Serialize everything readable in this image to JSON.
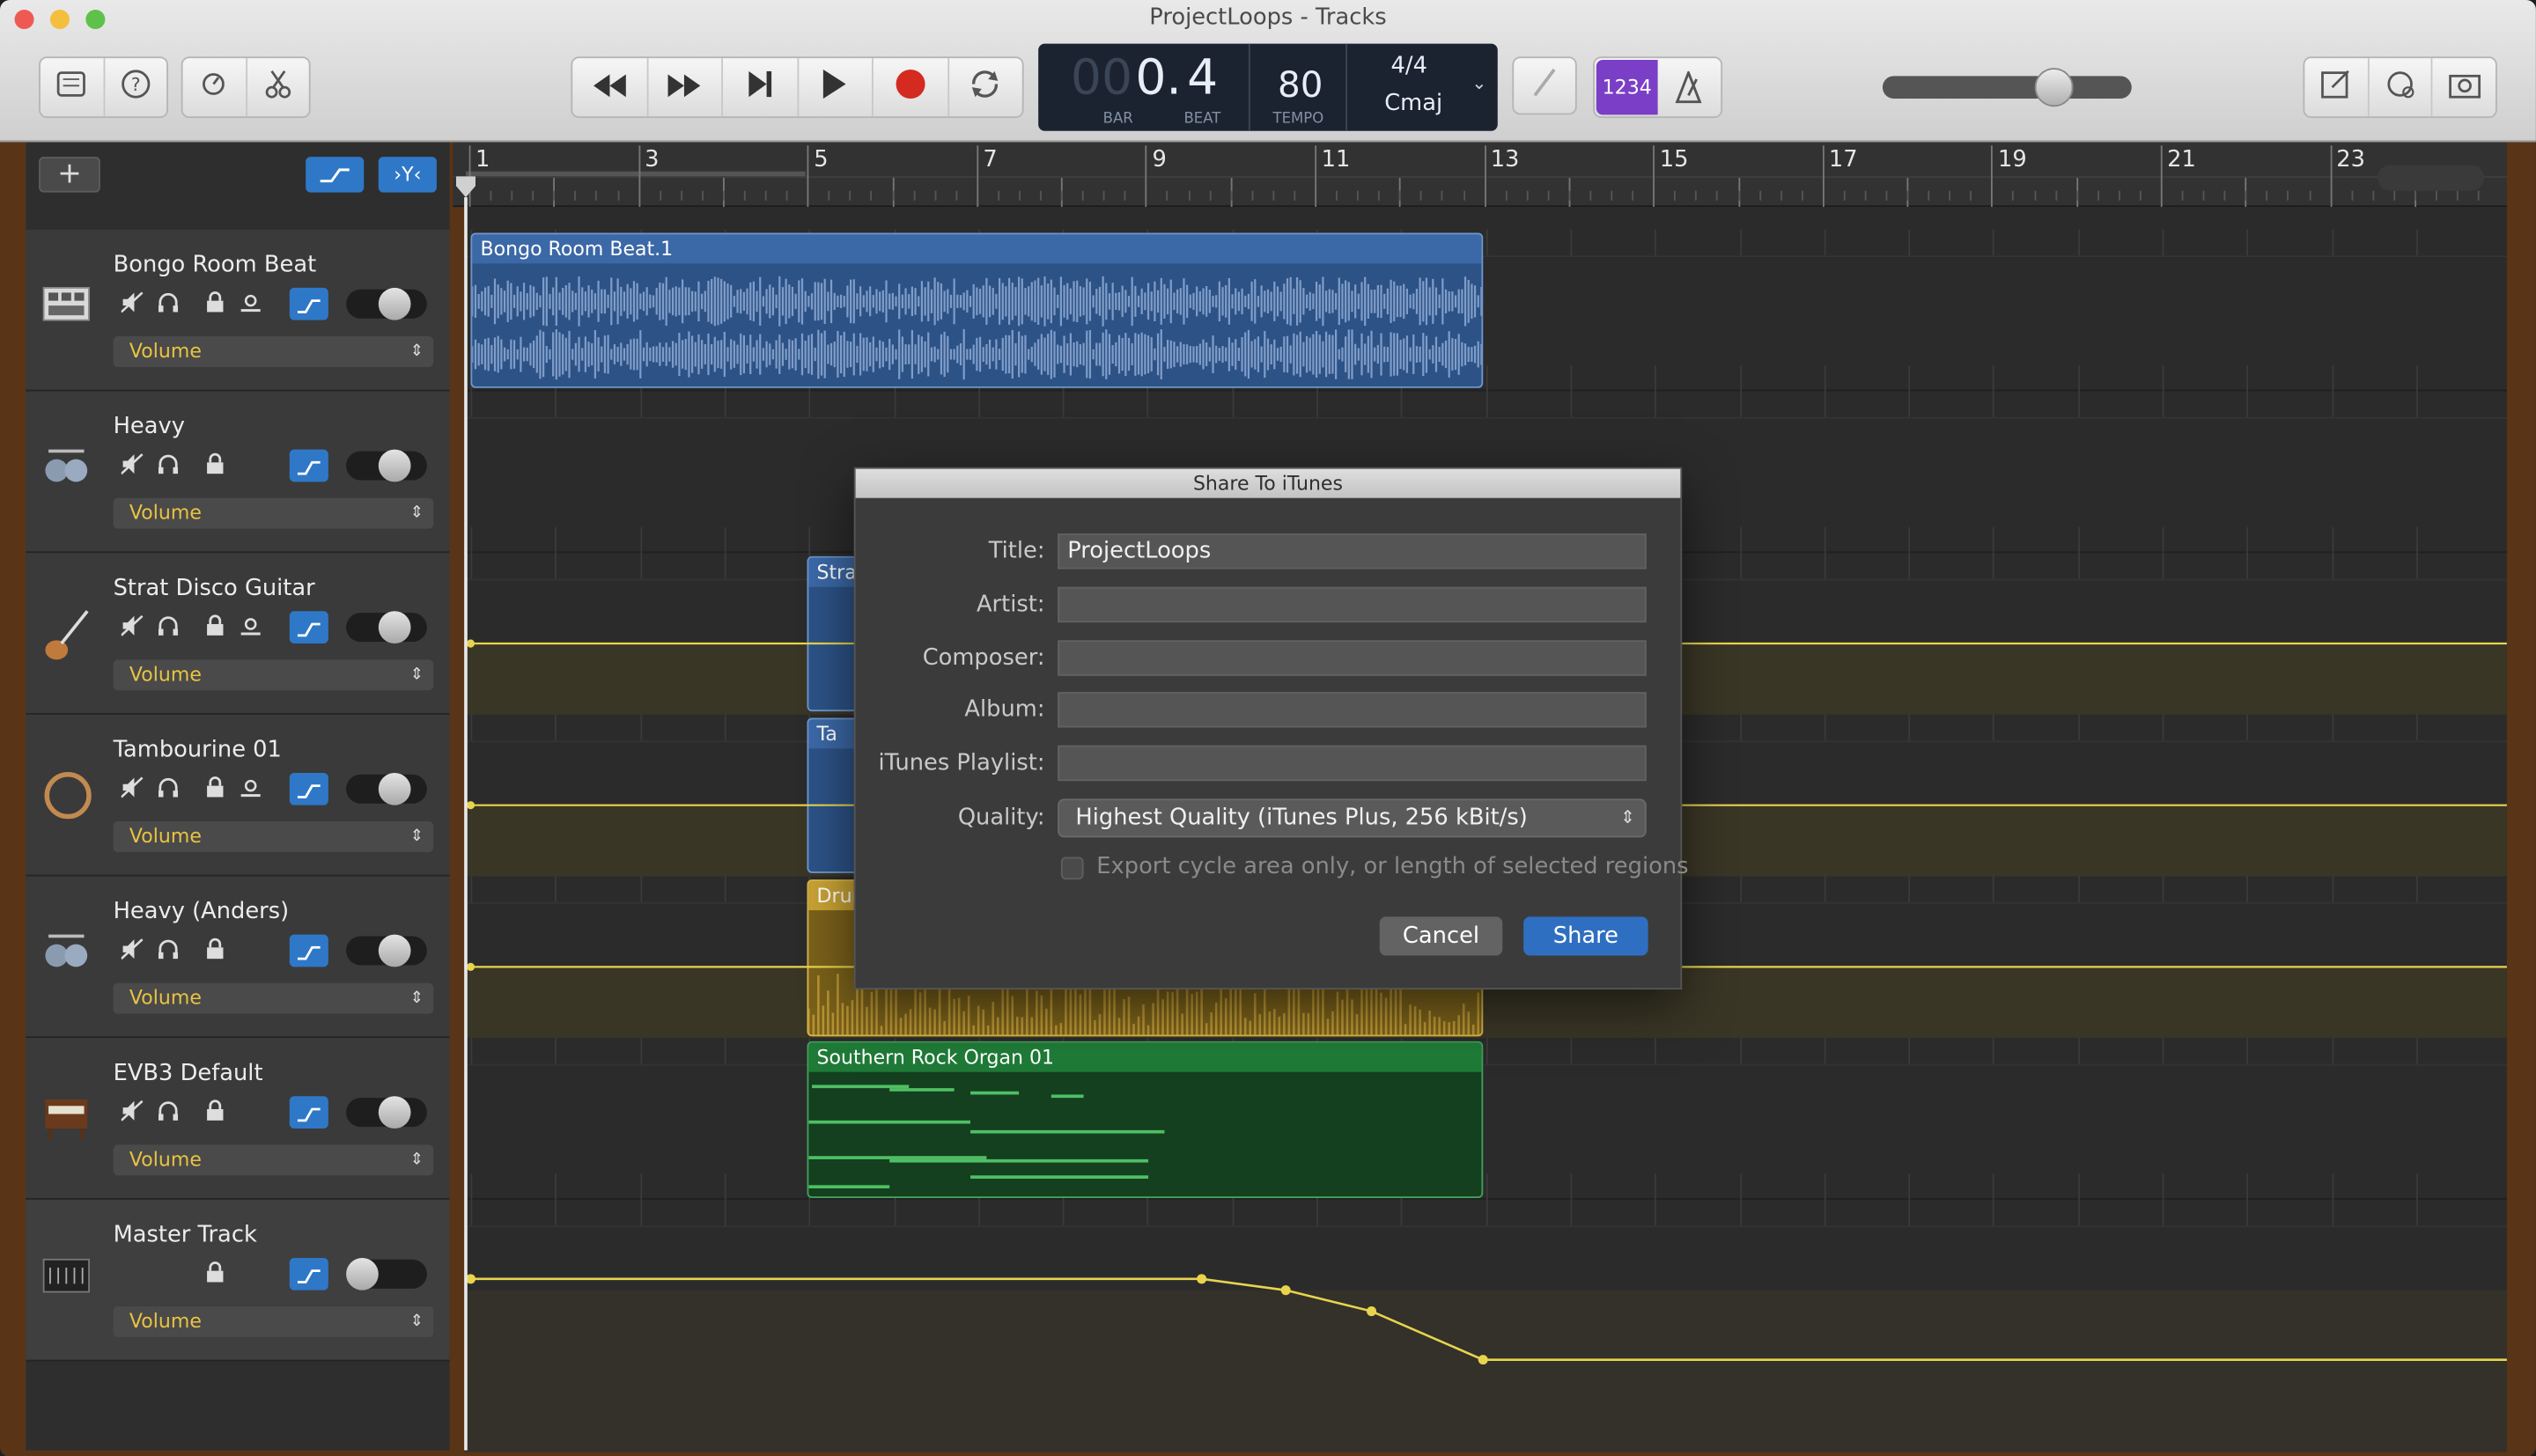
{
  "window": {
    "title": "ProjectLoops - Tracks"
  },
  "lcd": {
    "bar_dim": "00",
    "bar": "0.",
    "beat": "4",
    "bar_label": "BAR",
    "beat_label": "BEAT",
    "tempo": "80",
    "tempo_label": "TEMPO",
    "signature": "4/4",
    "key": "Cmaj"
  },
  "toolbar": {
    "count_in": "1234"
  },
  "add_label": "+",
  "ruler": {
    "bars": [
      "1",
      "3",
      "5",
      "7",
      "9",
      "11",
      "13",
      "15",
      "17",
      "19",
      "21",
      "23"
    ]
  },
  "tracks": [
    {
      "name": "Bongo Room Beat",
      "automation": "Volume"
    },
    {
      "name": "Heavy",
      "automation": "Volume"
    },
    {
      "name": "Strat Disco Guitar",
      "automation": "Volume"
    },
    {
      "name": "Tambourine 01",
      "automation": "Volume"
    },
    {
      "name": "Heavy (Anders)",
      "automation": "Volume"
    },
    {
      "name": "EVB3 Default",
      "automation": "Volume"
    },
    {
      "name": "Master Track",
      "automation": "Volume"
    }
  ],
  "regions": {
    "bongo": "Bongo Room Beat.1",
    "strat": "Stra",
    "tamb": "Ta",
    "drum": "Drun",
    "organ": "Southern Rock Organ 01"
  },
  "dialog": {
    "title": "Share To iTunes",
    "labels": {
      "title": "Title:",
      "artist": "Artist:",
      "composer": "Composer:",
      "album": "Album:",
      "playlist": "iTunes Playlist:",
      "quality": "Quality:"
    },
    "values": {
      "title": "ProjectLoops",
      "artist": "",
      "composer": "",
      "album": "",
      "playlist": ""
    },
    "quality": "Highest Quality (iTunes Plus, 256 kBit/s)",
    "checkbox": "Export cycle area only, or length of selected regions",
    "cancel": "Cancel",
    "share": "Share"
  },
  "colors": {
    "audio_region": "#2c5286",
    "drummer_region": "#c8a233",
    "midi_region": "#1d6b30",
    "automation": "#e8d44d",
    "accent": "#2f78c7",
    "count_in": "#7a3fc6"
  }
}
